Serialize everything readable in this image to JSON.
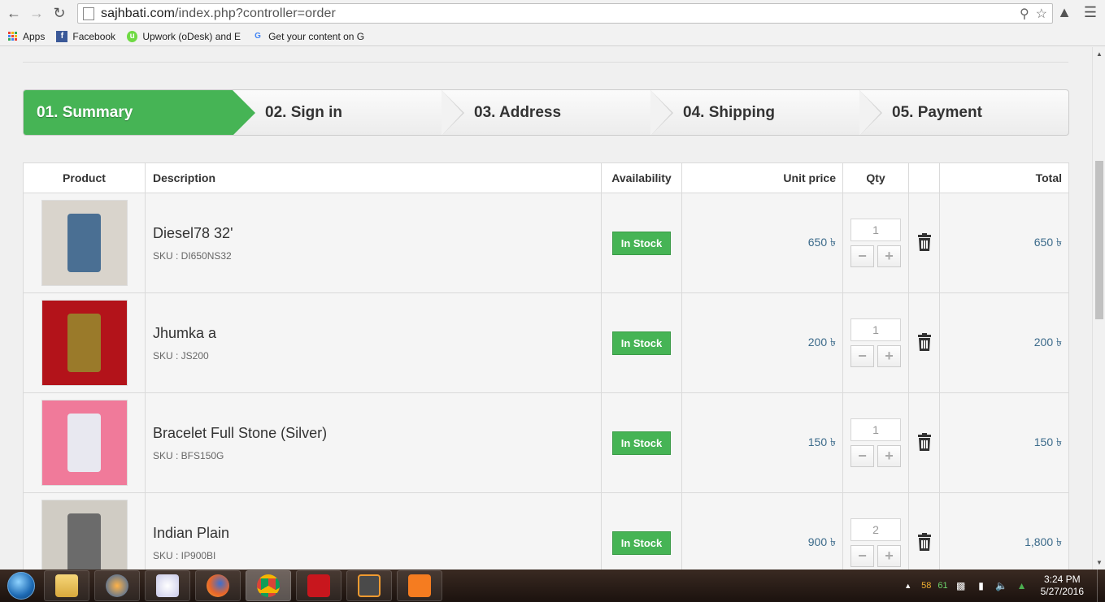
{
  "browser": {
    "url_host": "sajhbati.com",
    "url_path": "/index.php?controller=order",
    "bookmarks": [
      {
        "label": "Apps",
        "icon": "apps-grid-icon"
      },
      {
        "label": "Facebook",
        "icon": "facebook-icon"
      },
      {
        "label": "Upwork (oDesk) and E",
        "icon": "upwork-icon"
      },
      {
        "label": "Get your content on G",
        "icon": "google-icon"
      }
    ]
  },
  "steps": [
    {
      "label": "01. Summary",
      "active": true
    },
    {
      "label": "02. Sign in",
      "active": false
    },
    {
      "label": "03. Address",
      "active": false
    },
    {
      "label": "04. Shipping",
      "active": false
    },
    {
      "label": "05. Payment",
      "active": false
    }
  ],
  "cart": {
    "headers": {
      "product": "Product",
      "description": "Description",
      "availability": "Availability",
      "unit_price": "Unit price",
      "qty": "Qty",
      "delete": "",
      "total": "Total"
    },
    "rows": [
      {
        "name": "Diesel78 32'",
        "sku": "SKU : DI650NS32",
        "availability": "In Stock",
        "unit_price": "650 ৳",
        "qty": "1",
        "total": "650 ৳",
        "thumb_color": "#4a6f93",
        "thumb_bg": "#d9d4cc"
      },
      {
        "name": "Jhumka a",
        "sku": "SKU : JS200",
        "availability": "In Stock",
        "unit_price": "200 ৳",
        "qty": "1",
        "total": "200 ৳",
        "thumb_color": "#9a7a2a",
        "thumb_bg": "#b3131a"
      },
      {
        "name": "Bracelet Full Stone (Silver)",
        "sku": "SKU : BFS150G",
        "availability": "In Stock",
        "unit_price": "150 ৳",
        "qty": "1",
        "total": "150 ৳",
        "thumb_color": "#e8e8f0",
        "thumb_bg": "#f07a9a"
      },
      {
        "name": "Indian Plain",
        "sku": "SKU : IP900BI",
        "availability": "In Stock",
        "unit_price": "900 ৳",
        "qty": "2",
        "total": "1,800 ৳",
        "thumb_color": "#6b6b6b",
        "thumb_bg": "#d0ccc4"
      }
    ]
  },
  "taskbar": {
    "apps": [
      "windows-explorer-icon",
      "media-player-icon",
      "paint-icon",
      "firefox-icon",
      "chrome-icon",
      "acrobat-icon",
      "sublime-text-icon",
      "xampp-icon"
    ],
    "tray_num1": "58",
    "tray_num2": "61",
    "time": "3:24 PM",
    "date": "5/27/2016"
  },
  "colors": {
    "accent_green": "#46b455",
    "price_blue": "#3b6a8a"
  }
}
